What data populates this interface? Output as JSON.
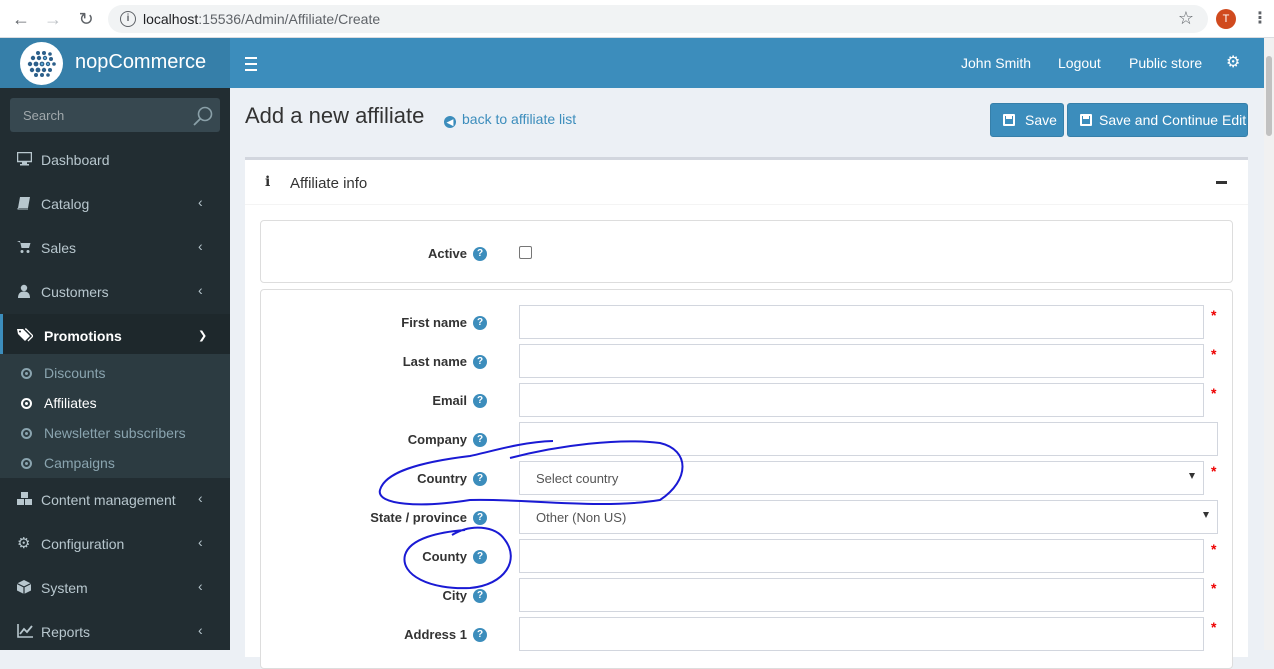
{
  "browser": {
    "url_host": "localhost",
    "url_path": ":15536/Admin/Affiliate/Create",
    "profile_initial": "T"
  },
  "header": {
    "logo_text": "nopCommerce",
    "user_name": "John Smith",
    "logout_label": "Logout",
    "public_store_label": "Public store"
  },
  "sidebar": {
    "search_placeholder": "Search",
    "items": [
      {
        "label": "Dashboard",
        "icon": "monitor-icon"
      },
      {
        "label": "Catalog",
        "icon": "book-icon"
      },
      {
        "label": "Sales",
        "icon": "cart-icon"
      },
      {
        "label": "Customers",
        "icon": "user-icon"
      },
      {
        "label": "Promotions",
        "icon": "tags-icon"
      },
      {
        "label": "Content management",
        "icon": "cubes-icon"
      },
      {
        "label": "Configuration",
        "icon": "gears-icon"
      },
      {
        "label": "System",
        "icon": "cube-icon"
      },
      {
        "label": "Reports",
        "icon": "line-chart-icon"
      }
    ],
    "promotions_submenu": [
      {
        "label": "Discounts"
      },
      {
        "label": "Affiliates"
      },
      {
        "label": "Newsletter subscribers"
      },
      {
        "label": "Campaigns"
      }
    ]
  },
  "content": {
    "page_title": "Add a new affiliate",
    "back_link": "back to affiliate list",
    "save_label": "Save",
    "save_continue_label": "Save and Continue Edit",
    "panel_title": "Affiliate info",
    "fields": {
      "active": "Active",
      "first_name": "First name",
      "last_name": "Last name",
      "email": "Email",
      "company": "Company",
      "country": "Country",
      "country_value": "Select country",
      "state": "State / province",
      "state_value": "Other (Non US)",
      "county": "County",
      "city": "City",
      "address1": "Address 1"
    },
    "required_mark": "*",
    "help_mark": "?"
  },
  "colors": {
    "sidebar_bg": "#222d32",
    "header_bg": "#3c8dbc",
    "logo_bg": "#367fa9",
    "annotation_ink": "#1a1ad4"
  }
}
